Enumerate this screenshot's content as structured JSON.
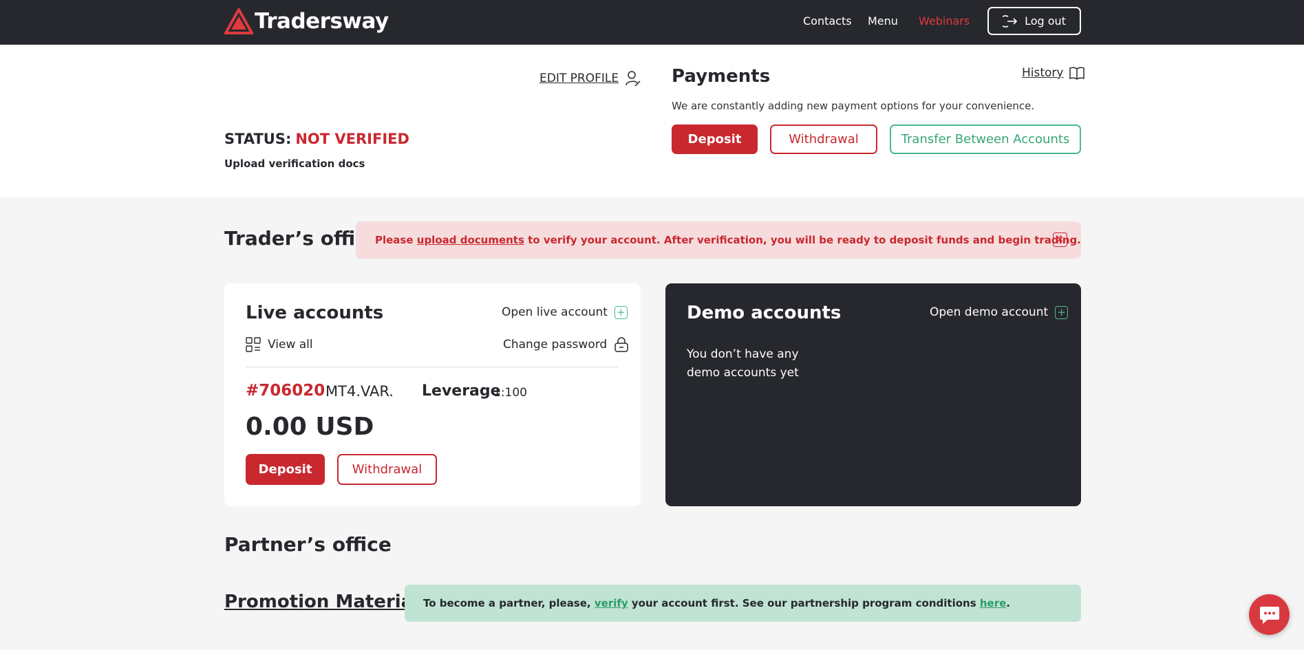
{
  "header": {
    "logo_text": "Tradersway",
    "nav": [
      {
        "label": "Contacts"
      },
      {
        "label": "Menu"
      },
      {
        "label": "Webinars"
      }
    ],
    "logout_label": "Log out"
  },
  "profile": {
    "edit_label": "EDIT PROFILE",
    "status_label": "STATUS:",
    "status_value": "NOT VERIFIED",
    "upload_label": "Upload verification docs"
  },
  "payments": {
    "title": "Payments",
    "history_label": "History",
    "description": "We are constantly adding new payment options for your convenience.",
    "deposit_label": "Deposit",
    "withdrawal_label": "Withdrawal",
    "transfer_label": "Transfer Between Accounts"
  },
  "traders_office": {
    "title": "Trader’s office",
    "alert_prefix": "Please ",
    "alert_link": "upload documents",
    "alert_suffix": " to verify your account. After verification, you will be ready to deposit funds and begin trading.",
    "alert_close": "×"
  },
  "live_accounts": {
    "title": "Live accounts",
    "open_label": "Open live account",
    "view_all_label": "View all",
    "change_password_label": "Change password",
    "account": {
      "number": "#706020",
      "type": "MT4.VAR.",
      "leverage_label": "Leverage",
      "leverage_value": "1:100",
      "balance": "0.00 USD",
      "deposit_label": "Deposit",
      "withdrawal_label": "Withdrawal"
    }
  },
  "demo_accounts": {
    "title": "Demo accounts",
    "open_label": "Open demo account",
    "empty_text": "You don’t have any demo accounts yet"
  },
  "partners_office": {
    "title": "Partner’s office",
    "promo_label": "Promotion Materials",
    "alert_prefix": "To become a partner, please, ",
    "alert_verify_link": "verify",
    "alert_middle": " your account first. See our partnership program conditions ",
    "alert_here_link": "here",
    "alert_suffix": "."
  },
  "colors": {
    "brand_red": "#c9282f",
    "header_dark": "#26282d",
    "accent_green": "#4cba8b"
  }
}
